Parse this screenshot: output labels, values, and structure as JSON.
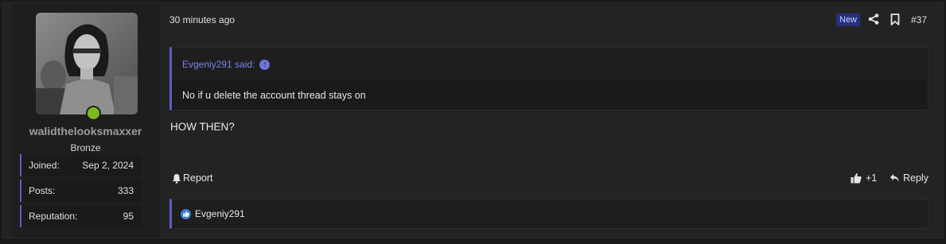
{
  "user": {
    "name": "walidthelooksmaxxer",
    "title": "Bronze",
    "stats": [
      {
        "label": "Joined:",
        "value": "Sep 2, 2024"
      },
      {
        "label": "Posts:",
        "value": "333"
      },
      {
        "label": "Reputation:",
        "value": "95"
      }
    ],
    "online_color": "#7dba1b"
  },
  "post": {
    "time": "30 minutes ago",
    "new_badge": "New",
    "number": "#37",
    "quote": {
      "author_line": "Evgeniy291 said:",
      "text": "No if u delete the account thread stays on"
    },
    "message": "HOW THEN?",
    "actions": {
      "report": "Report",
      "like_count": "+1",
      "reply": "Reply"
    },
    "reactions": {
      "users": "Evgeniy291"
    }
  },
  "colors": {
    "accent": "#5b5fc7",
    "link": "#7b82e6",
    "background": "#232324"
  }
}
